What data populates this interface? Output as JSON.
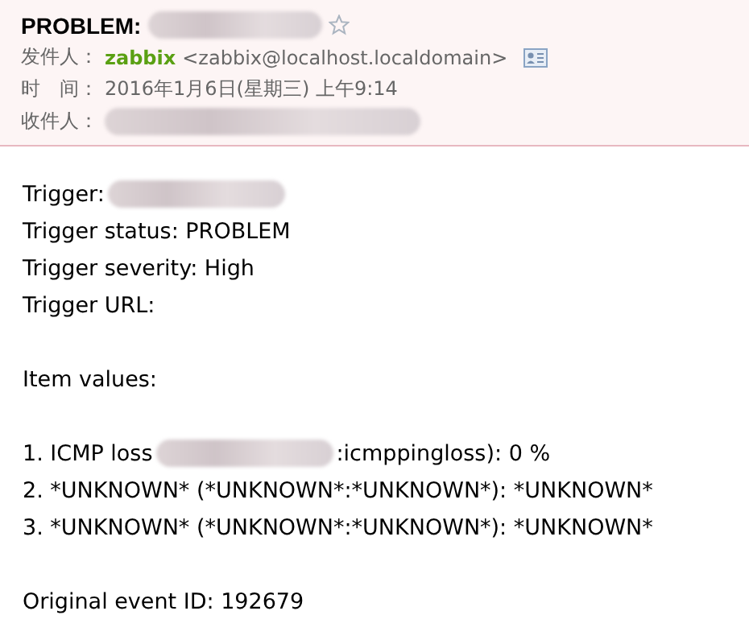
{
  "header": {
    "subject": "PROBLEM:",
    "starred": false,
    "fields": [
      {
        "kind": "sender",
        "label": "发件人：",
        "name": "zabbix",
        "address": "<zabbix@localhost.localdomain>"
      },
      {
        "kind": "time",
        "label": "时　间：",
        "value": "2016年1月6日(星期三) 上午9:14"
      },
      {
        "kind": "recipient",
        "label": "收件人："
      }
    ]
  },
  "body": [
    {
      "kind": "line",
      "parts": [
        {
          "kind": "text",
          "text": "Trigger:"
        },
        {
          "kind": "redacted"
        }
      ]
    },
    {
      "kind": "line",
      "parts": [
        {
          "kind": "text",
          "text": "Trigger status: PROBLEM"
        }
      ]
    },
    {
      "kind": "line",
      "parts": [
        {
          "kind": "text",
          "text": "Trigger severity: High"
        }
      ]
    },
    {
      "kind": "line",
      "parts": [
        {
          "kind": "text",
          "text": "Trigger URL:"
        }
      ]
    },
    {
      "kind": "blank"
    },
    {
      "kind": "line",
      "parts": [
        {
          "kind": "text",
          "text": "Item values:"
        }
      ]
    },
    {
      "kind": "blank"
    },
    {
      "kind": "line",
      "parts": [
        {
          "kind": "text",
          "text": "1. ICMP loss"
        },
        {
          "kind": "redacted"
        },
        {
          "kind": "text",
          "text": ":icmppingloss): 0 %"
        }
      ]
    },
    {
      "kind": "line",
      "parts": [
        {
          "kind": "text",
          "text": "2. *UNKNOWN* (*UNKNOWN*:*UNKNOWN*): *UNKNOWN*"
        }
      ]
    },
    {
      "kind": "line",
      "parts": [
        {
          "kind": "text",
          "text": "3. *UNKNOWN* (*UNKNOWN*:*UNKNOWN*): *UNKNOWN*"
        }
      ]
    },
    {
      "kind": "blank"
    },
    {
      "kind": "line",
      "parts": [
        {
          "kind": "text",
          "text": "Original event ID: 192679"
        }
      ]
    }
  ]
}
